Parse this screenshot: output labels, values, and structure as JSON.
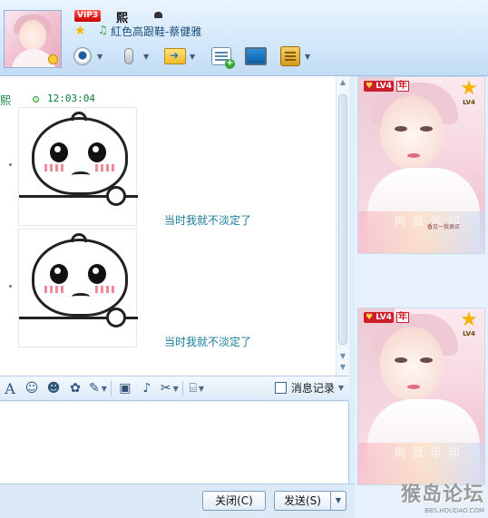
{
  "header": {
    "vip_label": "VIP3",
    "username": "熙",
    "signature": "紅色高跟鞋-蔡健雅",
    "toolbar": [
      {
        "name": "video-call",
        "icon": "webcam-icon"
      },
      {
        "name": "voice-call",
        "icon": "microphone-icon"
      },
      {
        "name": "send-file",
        "icon": "folder-send-icon"
      },
      {
        "name": "send-sms",
        "icon": "message-add-icon"
      },
      {
        "name": "remote-assist",
        "icon": "monitor-icon"
      },
      {
        "name": "apps",
        "icon": "app-box-icon"
      }
    ]
  },
  "chat": {
    "sender": "熙",
    "time": "12:03:04",
    "messages": [
      {
        "sticker": "crying-bun-sticker",
        "text": "当时我就不淡定了"
      },
      {
        "sticker": "crying-bun-sticker",
        "text": "当时我就不淡定了"
      }
    ]
  },
  "format_toolbar": {
    "history_label": "消息记录"
  },
  "buttons": {
    "close": "关闭(C)",
    "send": "发送(S)"
  },
  "show_cards": [
    {
      "level": "LV4",
      "tag": "年",
      "star_level": "LV4",
      "watermark": "阿 显 示 印",
      "small_text": "香见一我谢买"
    },
    {
      "level": "LV4",
      "tag": "年",
      "star_level": "LV4",
      "watermark": "阿 显 示 印",
      "small_text": ""
    }
  ],
  "forum_watermark": {
    "text": "猴岛论坛",
    "url": "BBS.HOUDAO.COM"
  }
}
